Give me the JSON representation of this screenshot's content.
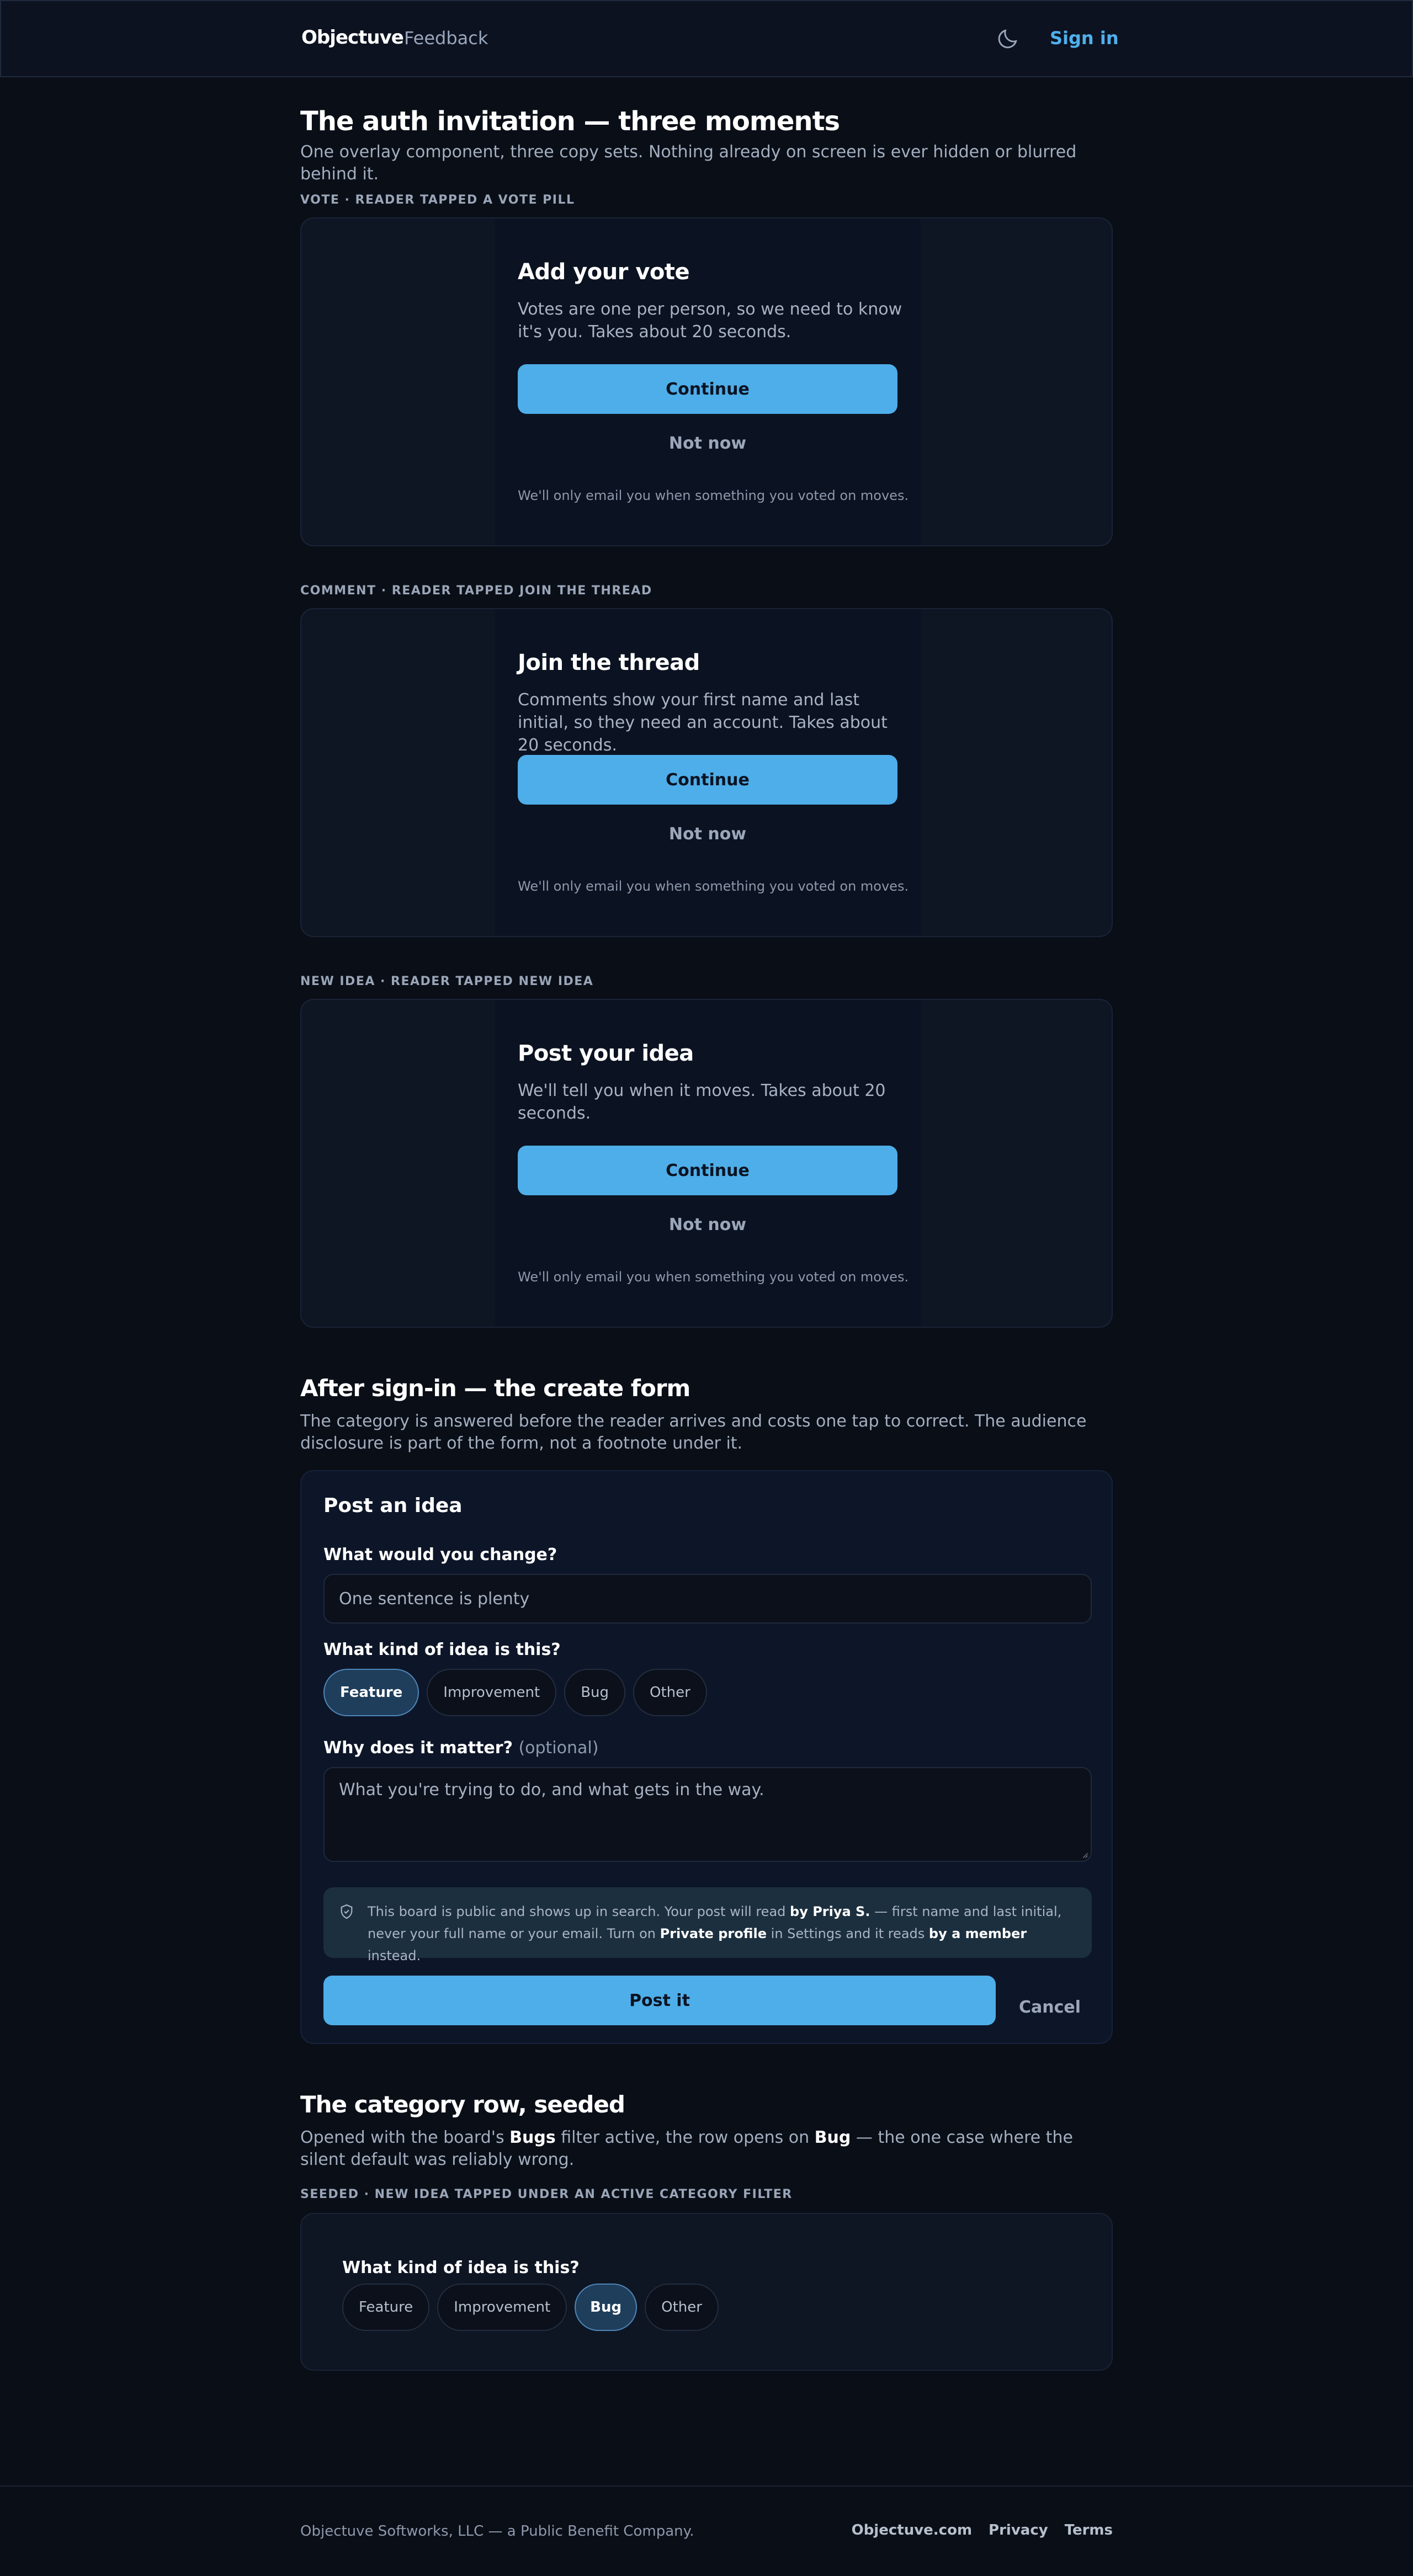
{
  "header": {
    "logo": "Objectuve",
    "nav_feedback": "Feedback",
    "signin": "Sign in",
    "theme_icon": "moon-icon"
  },
  "intro": {
    "title": "The auth invitation — three moments",
    "subtitle": "One overlay component, three copy sets. Nothing already on screen is ever hidden or blurred behind it."
  },
  "moments": [
    {
      "eyebrow": "VOTE · READER TAPPED A VOTE PILL",
      "title": "Add your vote",
      "body": "Votes are one per person, so we need to know it's you. Takes about 20 seconds.",
      "primary": "Continue",
      "secondary": "Not now",
      "fine": "We'll only email you when something you voted on moves."
    },
    {
      "eyebrow": "COMMENT · READER TAPPED JOIN THE THREAD",
      "title": "Join the thread",
      "body": "Comments show your first name and last initial, so they need an account. Takes about 20 seconds.",
      "primary": "Continue",
      "secondary": "Not now",
      "fine": "We'll only email you when something you voted on moves."
    },
    {
      "eyebrow": "NEW IDEA · READER TAPPED NEW IDEA",
      "title": "Post your idea",
      "body": "We'll tell you when it moves. Takes about 20 seconds.",
      "primary": "Continue",
      "secondary": "Not now",
      "fine": "We'll only email you when something you voted on moves."
    }
  ],
  "after": {
    "title": "After sign-in — the create form",
    "subtitle": "The category is answered before the reader arrives and costs one tap to correct. The audience disclosure is part of the form, not a footnote under it."
  },
  "form": {
    "title": "Post an idea",
    "q1": "What would you change?",
    "q1_placeholder": "One sentence is plenty",
    "q2": "What kind of idea is this?",
    "categories": [
      "Feature",
      "Improvement",
      "Bug",
      "Other"
    ],
    "selected": "Feature",
    "q3": "Why does it matter?",
    "q3_optional": "(optional)",
    "q3_placeholder": "What you're trying to do, and what gets in the way.",
    "notice_1": "This board is public and shows up in search. Your post will read ",
    "notice_name": "by Priya S.",
    "notice_2": " — first name and last initial, never your full name or your email. Turn on ",
    "notice_setting": "Private profile",
    "notice_3": " in Settings and it reads ",
    "notice_member": "by a member",
    "notice_4": " instead.",
    "submit": "Post it",
    "cancel": "Cancel"
  },
  "seeded": {
    "title": "The category row, seeded",
    "sub_1": "Opened with the board's ",
    "sub_filter": "Bugs",
    "sub_2": " filter active, the row opens on ",
    "sub_bug": "Bug",
    "sub_3": " — the one case where the silent default was reliably wrong.",
    "eyebrow": "SEEDED · NEW IDEA TAPPED UNDER AN ACTIVE CATEGORY FILTER",
    "question": "What kind of idea is this?",
    "categories": [
      "Feature",
      "Improvement",
      "Bug",
      "Other"
    ],
    "selected": "Bug"
  },
  "footer": {
    "copyright": "Objectuve Softworks, LLC — a Public Benefit Company.",
    "links": [
      "Objectuve.com",
      "Privacy",
      "Terms"
    ]
  }
}
